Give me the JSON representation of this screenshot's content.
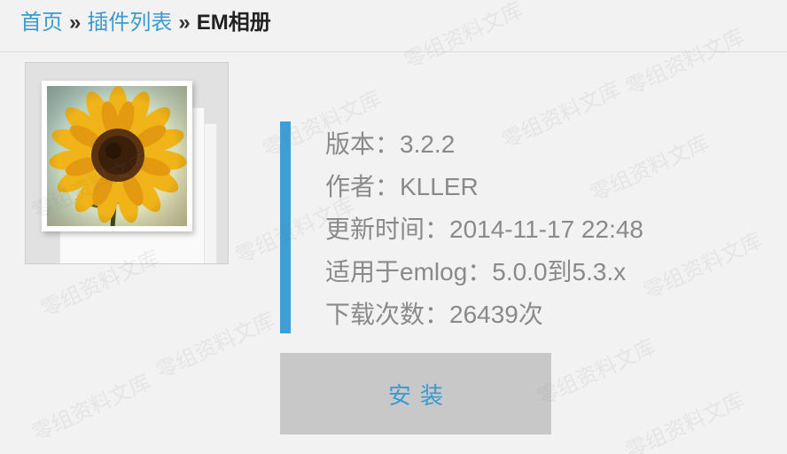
{
  "breadcrumb": {
    "home": "首页",
    "separator_1": "»",
    "plugin_list": "插件列表",
    "separator_2": "»",
    "current": "EM相册"
  },
  "plugin": {
    "icon": "sunflower-photo-stack-icon",
    "version": "版本：3.2.2",
    "author": "作者：KLLER",
    "updated": "更新时间：2014-11-17 22:48",
    "compatibility": "适用于emlog：5.0.0到5.3.x",
    "downloads": "下载次数：26439次"
  },
  "actions": {
    "install_label": "安装"
  },
  "watermark": {
    "text": "零组资料文库"
  },
  "colors": {
    "link": "#3a9bd0",
    "accent_bar": "#3d9fd5",
    "button_bg": "#c8c8c8",
    "page_bg": "#f2f2f2",
    "info_text": "#8a8a8a"
  }
}
